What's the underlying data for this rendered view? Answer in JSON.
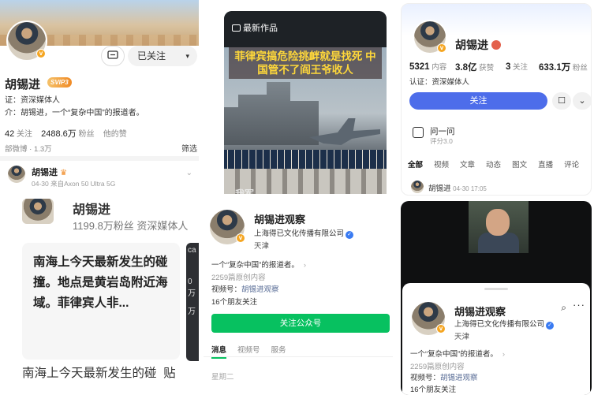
{
  "colors": {
    "follow_blue": "#4d6dea",
    "wechat_green": "#07c160",
    "caption_yellow": "#ffd83a",
    "vip_orange": "#f08a24"
  },
  "weibo_profile": {
    "message_icon": "message-icon",
    "follow_state": "已关注",
    "caret": "▾",
    "name": "胡锡进",
    "vip_badge": "SVIP3",
    "auth_line": "证：资深媒体人",
    "bio_line": "介：胡锡进，一个“复杂中国”的报道者。",
    "following_count": "42",
    "following_label": "关注",
    "fans_count": "2488.6万",
    "fans_label": "粉丝",
    "other_label": "他的赞",
    "all_weibo": "部微博 · 1.3万",
    "filter": "筛选",
    "post_author": "胡锡进",
    "post_meta": "04-30 来自Axon 50 Ultra 5G",
    "chevron": "⌄"
  },
  "video_still": {
    "label": "最新作品",
    "caption": "菲律宾搞危险挑衅就是找死 中国管不了阎王爷收人",
    "subtitle": "我军..."
  },
  "douyin_profile": {
    "name": "胡锡进",
    "stats": [
      {
        "value": "5321",
        "label": "内容"
      },
      {
        "value": "3.8亿",
        "label": "获赞"
      },
      {
        "value": "3",
        "label": "关注"
      },
      {
        "value": "633.1万",
        "label": "粉丝"
      }
    ],
    "auth": "认证：资深媒体人",
    "follow_button": "关注",
    "message_icon": "☐",
    "expand_icon": "⌄",
    "qa_title": "问一问",
    "qa_sub": "评分3.0",
    "tabs": [
      "全部",
      "视频",
      "文章",
      "动态",
      "图文",
      "直播",
      "评论"
    ],
    "post_author": "胡锡进",
    "post_time": "04-30 17:05"
  },
  "text_post": {
    "name": "胡锡进",
    "fans": "1199.8万粉丝  资深媒体人",
    "card_text": "南海上今天最新发生的碰撞。地点是黄岩岛附近海域。菲律宾人非...",
    "below_text": "南海上今天最新发生的碰",
    "side_a": "ca",
    "side_b": "0万",
    "side_c": "万",
    "side_d": "贴"
  },
  "wechat_account": {
    "name": "胡锡进观察",
    "company": "上海得已文化传播有限公司",
    "check": "✓",
    "city": "天津",
    "description": "一个“复杂中国”的报道者。",
    "desc_arrow": "›",
    "article_count": "2259篇原创内容",
    "video_prefix": "视频号：",
    "video_name": "胡锡进观察",
    "friends": "16个朋友关注",
    "follow_button": "关注公众号",
    "tabs": [
      "消息",
      "视频号",
      "服务"
    ],
    "day_label": "星期二"
  },
  "popup_card": {
    "name": "胡锡进观察",
    "company": "上海得已文化传播有限公司",
    "check": "✓",
    "city": "天津",
    "search_icon": "⌕",
    "more_icon": "···",
    "description": "一个“复杂中国”的报道者。",
    "desc_arrow": "›",
    "article_count": "2259篇原创内容",
    "video_prefix": "视频号：",
    "video_name": "胡锡进观察",
    "friends": "16个朋友关注"
  }
}
